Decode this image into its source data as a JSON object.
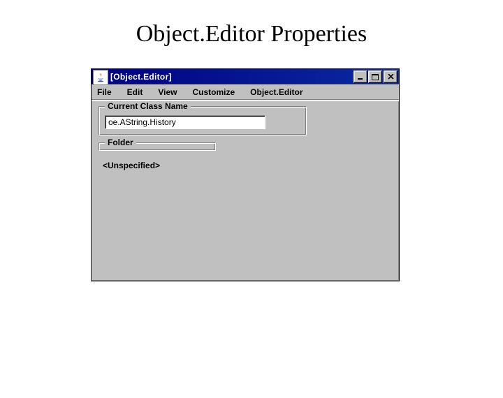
{
  "slide": {
    "title": "Object.Editor Properties"
  },
  "window": {
    "title": "[Object.Editor]",
    "menus": {
      "file": "File",
      "edit": "Edit",
      "view": "View",
      "customize": "Customize",
      "objecteditor": "Object.Editor"
    },
    "groups": {
      "currentClass": {
        "legend": "Current Class Name",
        "value": "oe.AString.History"
      },
      "folder": {
        "legend": "Folder",
        "value": "<Unspecified>"
      }
    }
  }
}
